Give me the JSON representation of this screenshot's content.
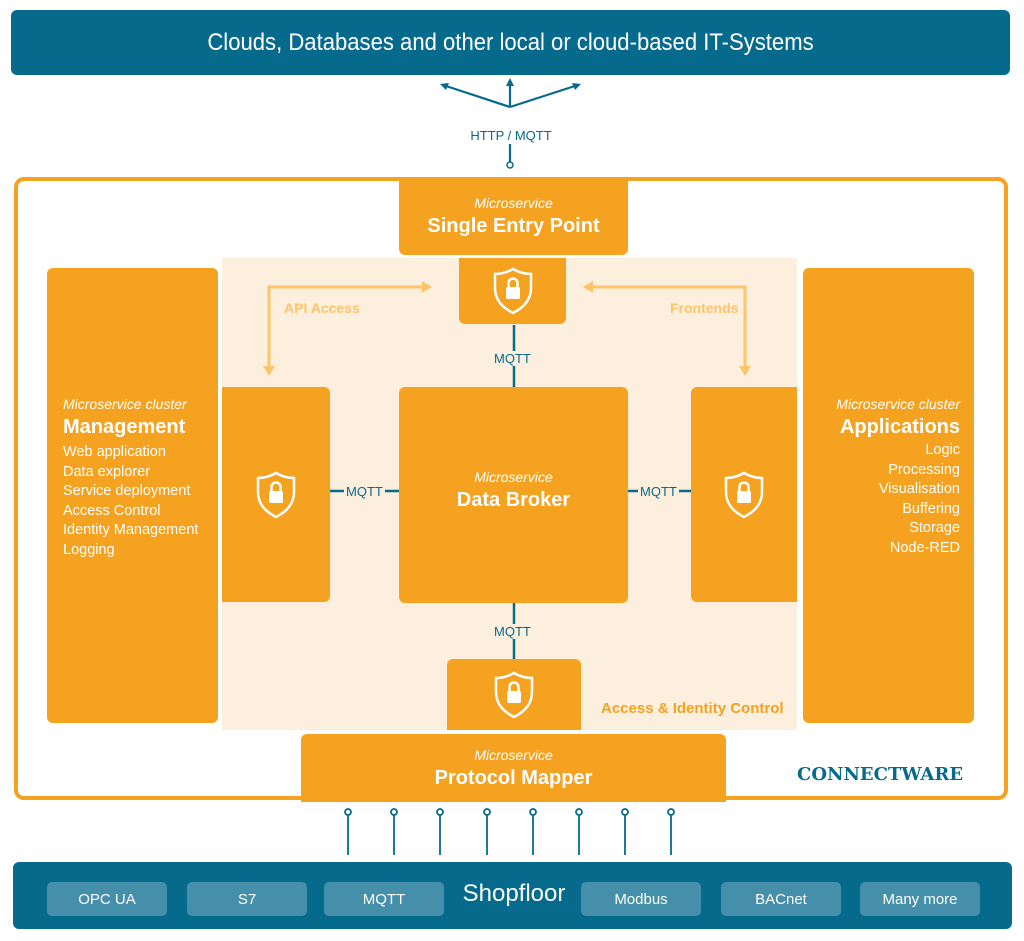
{
  "top": {
    "title": "Clouds, Databases and other local or cloud-based IT-Systems"
  },
  "uplink": {
    "label": "HTTP / MQTT"
  },
  "single_entry": {
    "kind": "Microservice",
    "title": "Single Entry Point"
  },
  "management": {
    "kind": "Microservice cluster",
    "title": "Management",
    "items": [
      "Web application",
      "Data explorer",
      "Service deployment",
      "Access Control",
      "Identity Management",
      "Logging"
    ]
  },
  "applications": {
    "kind": "Microservice cluster",
    "title": "Applications",
    "items": [
      "Logic",
      "Processing",
      "Visualisation",
      "Buffering",
      "Storage",
      "Node-RED"
    ]
  },
  "data_broker": {
    "kind": "Microservice",
    "title": "Data Broker"
  },
  "protocol_mapper": {
    "kind": "Microservice",
    "title": "Protocol Mapper"
  },
  "links": {
    "top": "MQTT",
    "left": "MQTT",
    "right": "MQTT",
    "bottom": "MQTT",
    "api_access": "API Access",
    "frontends": "Frontends"
  },
  "access_identity": {
    "label": "Access & Identity Control"
  },
  "brand": {
    "name": "CONNECTWARE"
  },
  "shopfloor": {
    "title": "Shopfloor",
    "protocols": [
      "OPC UA",
      "S7",
      "MQTT",
      "Modbus",
      "BACnet",
      "Many more"
    ]
  },
  "colors": {
    "blue": "#066a8c",
    "orange": "#f4a21f",
    "cream": "#fdefdd",
    "pale_orange": "#fcc46b",
    "chip": "#458fab"
  }
}
